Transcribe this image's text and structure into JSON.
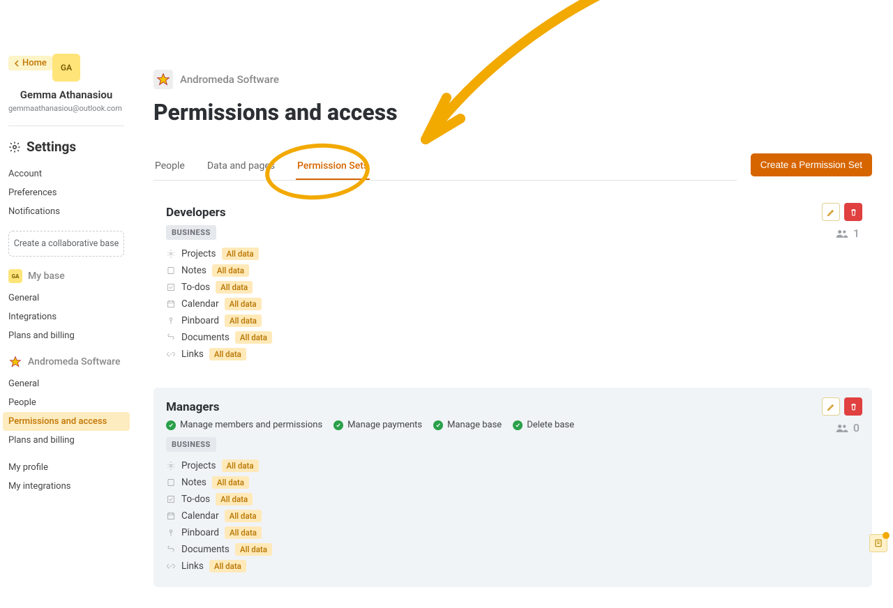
{
  "home_label": "Home",
  "user": {
    "initials": "GA",
    "name": "Gemma Athanasiou",
    "email": "gemmaathanasiou@outlook.com"
  },
  "settings_heading": "Settings",
  "nav_settings": [
    "Account",
    "Preferences",
    "Notifications"
  ],
  "create_base_label": "Create a collaborative base",
  "my_base_label": "My base",
  "nav_mybase": [
    "General",
    "Integrations",
    "Plans and billing"
  ],
  "workspace_name": "Andromeda Software",
  "nav_workspace": [
    "General",
    "People",
    "Permissions and access",
    "Plans and billing"
  ],
  "nav_workspace_active": 2,
  "nav_personal": [
    "My profile",
    "My integrations"
  ],
  "page_title": "Permissions and access",
  "tabs": [
    "People",
    "Data and pages",
    "Permission Sets"
  ],
  "active_tab": 2,
  "create_btn_label": "Create a Permission Set",
  "biz_tag": "BUSINESS",
  "all_data_label": "All data",
  "features": [
    "Projects",
    "Notes",
    "To-dos",
    "Calendar",
    "Pinboard",
    "Documents",
    "Links"
  ],
  "cards": [
    {
      "title": "Developers",
      "member_count": "1",
      "perms": []
    },
    {
      "title": "Managers",
      "member_count": "0",
      "perms": [
        "Manage members and permissions",
        "Manage payments",
        "Manage base",
        "Delete base"
      ]
    }
  ]
}
